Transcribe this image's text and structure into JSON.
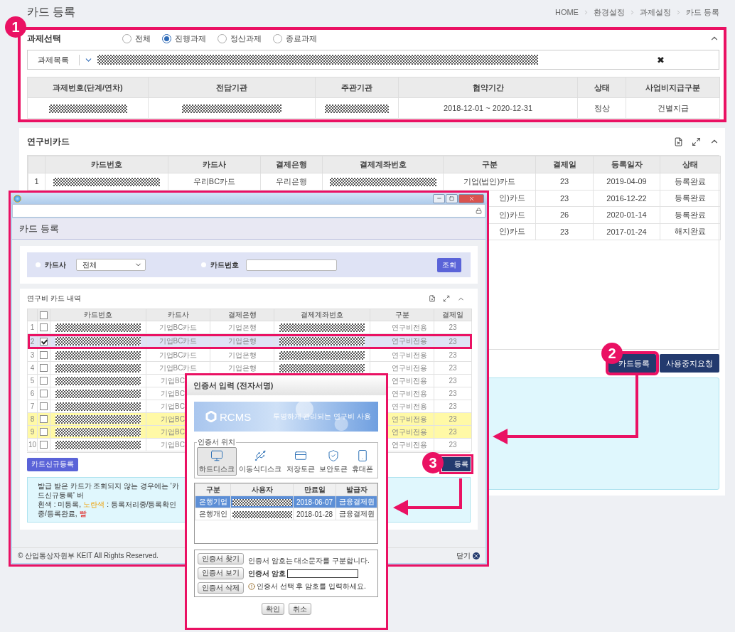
{
  "page": {
    "title": "카드 등록",
    "breadcrumb": [
      "HOME",
      "환경설정",
      "과제설정",
      "카드 등록"
    ]
  },
  "project_select": {
    "title": "과제선택",
    "options": [
      {
        "label": "전체",
        "selected": false
      },
      {
        "label": "진행과제",
        "selected": true
      },
      {
        "label": "정산과제",
        "selected": false
      },
      {
        "label": "종료과제",
        "selected": false
      }
    ],
    "list_label": "과제목록",
    "clear": "✖",
    "table": {
      "columns": [
        "과제번호(단계/연차)",
        "전담기관",
        "주관기관",
        "협약기간",
        "상태",
        "사업비지급구분"
      ],
      "rows": [
        [
          {
            "kind": "masked"
          },
          {
            "kind": "masked"
          },
          {
            "kind": "masked"
          },
          "2018-12-01 ~ 2020-12-31",
          "정상",
          "건별지급"
        ]
      ]
    }
  },
  "card_panel": {
    "title": "연구비카드",
    "columns": [
      "",
      "카드번호",
      "카드사",
      "결제은행",
      "결제계좌번호",
      "구분",
      "결제일",
      "등록일자",
      "상태"
    ],
    "rows": [
      {
        "cells": [
          "1",
          {
            "kind": "masked"
          },
          "우리BC카드",
          "우리은행",
          {
            "kind": "masked"
          },
          "기업(법인)카드",
          "23",
          "2019-04-09",
          "등록완료"
        ]
      },
      {
        "cells": [
          null,
          null,
          null,
          null,
          null,
          "인)카드",
          "23",
          "2016-12-22",
          "등록완료"
        ]
      },
      {
        "cells": [
          null,
          null,
          null,
          null,
          null,
          "인)카드",
          "26",
          "2020-01-14",
          "등록완료"
        ]
      },
      {
        "cells": [
          null,
          null,
          null,
          null,
          null,
          "인)카드",
          "23",
          "2017-01-24",
          "해지완료"
        ]
      }
    ],
    "buttons": [
      "카드등록",
      "사용중지요청"
    ]
  },
  "popup": {
    "title": "카드 등록",
    "search": {
      "company_label": "카드사",
      "company_value": "전체",
      "number_label": "카드번호",
      "button": "조회"
    },
    "list_title": "연구비 카드 내역",
    "select_all_checked": false,
    "columns": [
      "",
      "카드번호",
      "카드사",
      "결제은행",
      "결제계좌번호",
      "구분",
      "결제일"
    ],
    "rows": [
      {
        "checked": false,
        "selected": false,
        "color": "#ffffff",
        "cells": [
          "1",
          {
            "kind": "masked"
          },
          "기업BC카드",
          "기업은행",
          {
            "kind": "masked"
          },
          "연구비전용",
          "23"
        ]
      },
      {
        "checked": true,
        "selected": true,
        "color": "#dfe3f5",
        "cells": [
          "2",
          {
            "kind": "masked"
          },
          "기업BC카드",
          "기업은행",
          {
            "kind": "masked"
          },
          "연구비전용",
          "23"
        ]
      },
      {
        "checked": false,
        "selected": false,
        "color": "#ffffff",
        "cells": [
          "3",
          {
            "kind": "masked"
          },
          "기업BC카드",
          "기업은행",
          {
            "kind": "masked"
          },
          "연구비전용",
          "23"
        ]
      },
      {
        "checked": false,
        "selected": false,
        "color": "#ffffff",
        "cells": [
          "4",
          {
            "kind": "masked"
          },
          "기업BC카드",
          "기업은행",
          {
            "kind": "masked"
          },
          "연구비전용",
          "23"
        ]
      },
      {
        "checked": false,
        "selected": false,
        "color": "#ffffff",
        "cells": [
          "5",
          {
            "kind": "masked"
          },
          "기업BC",
          null,
          null,
          "연구비전용",
          "23"
        ]
      },
      {
        "checked": false,
        "selected": false,
        "color": "#ffffff",
        "cells": [
          "6",
          {
            "kind": "masked"
          },
          "기업BC",
          null,
          null,
          "연구비전용",
          "23"
        ]
      },
      {
        "checked": false,
        "selected": false,
        "color": "#ffffff",
        "cells": [
          "7",
          {
            "kind": "masked"
          },
          "기업BC",
          null,
          null,
          "연구비전용",
          "23"
        ]
      },
      {
        "checked": false,
        "selected": false,
        "color": "#fff9a6",
        "cells": [
          "8",
          {
            "kind": "masked"
          },
          "기업BC",
          null,
          null,
          "연구비전용",
          "23"
        ]
      },
      {
        "checked": false,
        "selected": false,
        "color": "#fff9a6",
        "cells": [
          "9",
          {
            "kind": "masked"
          },
          "기업BC",
          null,
          null,
          "연구비전용",
          "23"
        ]
      },
      {
        "checked": false,
        "selected": false,
        "color": "#ffffff",
        "cells": [
          "10",
          {
            "kind": "masked"
          },
          "기업BC",
          null,
          null,
          "연구비전용",
          "23"
        ]
      }
    ],
    "new_button": "카드신규등록",
    "register_button": "등록",
    "info": [
      "발급 받은 카드가 조회되지 않는 경우에는 '카드신규등록' 버"
    ],
    "legend": [
      {
        "text": "흰색 : 미등록,",
        "kind": "plain"
      },
      {
        "text": "노란색",
        "kind": "yellow"
      },
      {
        "text": ": 등록처리중/등록확인중/등록완료,",
        "kind": "plain"
      },
      {
        "text": "빨",
        "kind": "red"
      }
    ],
    "footer": "© 산업통상자원부 KEIT All Rights Reserved.",
    "close": "닫기"
  },
  "cert_dialog": {
    "title": "인증서 입력 (전자서명)",
    "banner_logo": "RCMS",
    "banner_slogan": "투명하게 관리되는 연구비 사용",
    "location_legend": "인증서 위치",
    "locations": [
      {
        "kind": "harddisk",
        "label": "하드디스크",
        "selected": true
      },
      {
        "kind": "usb",
        "label": "이동식디스크",
        "selected": false
      },
      {
        "kind": "token",
        "label": "저장토큰",
        "selected": false
      },
      {
        "kind": "secure",
        "label": "보안토큰",
        "selected": false
      },
      {
        "kind": "phone",
        "label": "휴대폰",
        "selected": false
      }
    ],
    "columns": [
      "구분",
      "사용자",
      "만료일",
      "발급자"
    ],
    "certs": [
      {
        "type": "은행기업",
        "expiry": "2018-06-07",
        "issuer": "금융결제원",
        "selected": true
      },
      {
        "type": "은행개인",
        "expiry": "2018-01-28",
        "issuer": "금융결제원",
        "selected": false
      }
    ],
    "side_buttons": [
      "인증서 찾기",
      "인증서 보기",
      "인증서 삭제"
    ],
    "note": "인증서 암호는 대소문자를 구분합니다.",
    "password_label": "인증서 암호",
    "warning": "인증서 선택 후 암호를 입력하세요.",
    "actions": [
      "확인",
      "취소"
    ]
  },
  "annotations": [
    {
      "number": "1"
    },
    {
      "number": "2"
    },
    {
      "number": "3"
    }
  ]
}
